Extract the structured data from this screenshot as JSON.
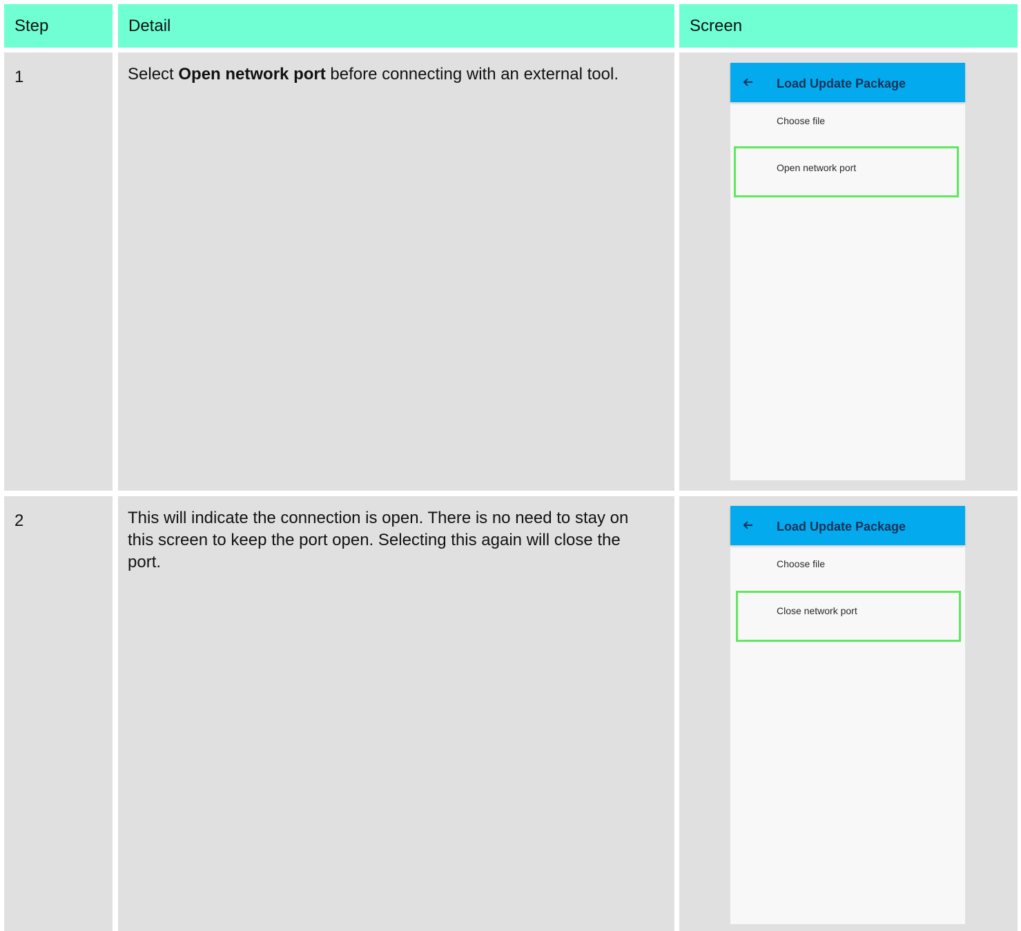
{
  "table": {
    "headers": {
      "step": "Step",
      "detail": "Detail",
      "screen": "Screen"
    },
    "rows": [
      {
        "step": "1",
        "detail": {
          "before": "Select ",
          "bold": "Open network port",
          "after": " before connecting with an external tool."
        },
        "screen": {
          "appbar_title": "Load Update Package",
          "item_choose": "Choose file",
          "item_port": "Open network port"
        }
      },
      {
        "step": "2",
        "detail": {
          "text": "This will indicate the connection is open. There is no need to stay on this screen to keep the port open. Selecting this again will close the port."
        },
        "screen": {
          "appbar_title": "Load Update Package",
          "item_choose": "Choose file",
          "item_port": "Close network port"
        }
      }
    ]
  },
  "colors": {
    "header_bg": "#6fffd2",
    "cell_bg": "#e0e0e0",
    "appbar_bg": "#03aaee",
    "highlight_border": "#5ee85e"
  },
  "icons": {
    "back": "arrow-left-icon"
  }
}
